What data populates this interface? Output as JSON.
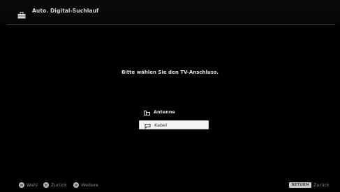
{
  "header": {
    "title": "Auto. Digital-Suchlauf",
    "icon": "toolbox-icon"
  },
  "main": {
    "prompt": "Bitte wählen Sie den TV-Anschluss.",
    "options": [
      {
        "label": "Antenne",
        "icon": "antenna-icon",
        "selected": false
      },
      {
        "label": "Kabel",
        "icon": "cable-icon",
        "selected": true
      }
    ]
  },
  "footer": {
    "hints": [
      {
        "label": "Wahl",
        "icon": "navigate-button-icon"
      },
      {
        "label": "Zurück",
        "icon": "back-button-icon"
      },
      {
        "label": "Weitere",
        "icon": "options-button-icon"
      }
    ],
    "return_key": "RETURN",
    "return_label": "Zurück"
  },
  "colors": {
    "background": "#000000",
    "text": "#e4e4e4",
    "highlight": "#f3f3f3",
    "footer_text": "#8c8c8c"
  }
}
